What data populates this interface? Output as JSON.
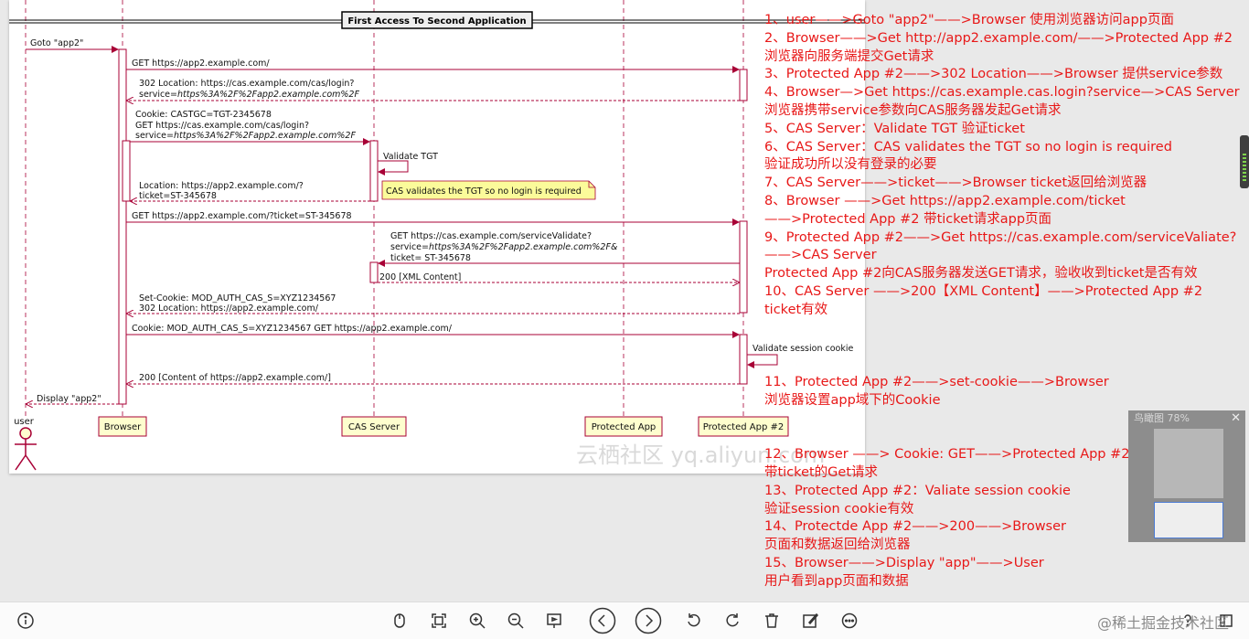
{
  "diagram": {
    "title": "First Access To Second Application",
    "participants": {
      "user": "user",
      "browser": "Browser",
      "cas": "CAS Server",
      "app1": "Protected App",
      "app2": "Protected App #2"
    },
    "messages": {
      "m1": "Goto \"app2\"",
      "m2": "GET https://app2.example.com/",
      "m3a": "302 Location: https://cas.example.com/cas/login?",
      "m3b_plain": "service=",
      "m3b_italic": "https%3A%2F%2Fapp2.example.com%2F",
      "m4a": "Cookie: CASTGC=TGT-2345678",
      "m4b": "GET https://cas.example.com/cas/login?",
      "m4c_plain": "service=",
      "m4c_italic": "https%3A%2F%2Fapp2.example.com%2F",
      "m5": "Validate TGT",
      "note": "CAS validates the TGT so no login is required",
      "m6a": "Location: https://app2.example.com/?",
      "m6b": "ticket=ST-345678",
      "m7": "GET https://app2.example.com/?ticket=ST-345678",
      "m8a": "GET https://cas.example.com/serviceValidate?",
      "m8b_plain": "service=",
      "m8b_italic": "https%3A%2F%2Fapp2.example.com%2F&",
      "m8c": "ticket= ST-345678",
      "m9": "200 [XML Content]",
      "m10a": "Set-Cookie: MOD_AUTH_CAS_S=XYZ1234567",
      "m10b": "302 Location: https://app2.example.com/",
      "m11": "Cookie: MOD_AUTH_CAS_S=XYZ1234567 GET https://app2.example.com/",
      "m12": "Validate session cookie",
      "m13": "200 [Content of https://app2.example.com/]",
      "m14": "Display \"app2\""
    }
  },
  "watermark_center": "云栖社区 yq.aliyun.com",
  "watermark_corner": "@稀土掘金技术社区",
  "notes": [
    "1、user——>Goto \"app2\"——>Browser 使用浏览器访问app页面",
    "2、Browser——>Get http://app2.example.com/——>Protected App #2",
    "浏览器向服务端提交Get请求",
    "3、Protected App #2——>302 Location——>Browser 提供service参数",
    "4、Browser—>Get https://cas.example.cas.login?service—>CAS Server",
    "浏览器携带service参数向CAS服务器发起Get请求",
    "5、CAS Server：Validate TGT 验证ticket",
    "6、CAS Server：CAS validates the TGT so no login is required",
    "验证成功所以没有登录的必要",
    "7、CAS Server——>ticket——>Browser ticket返回给浏览器",
    "8、Browser ——>Get https://app2.example.com/ticket",
    "——>Protected App #2 带ticket请求app页面",
    "9、Protected App #2——>Get https://cas.example.com/serviceValiate?",
    "——>CAS Server",
    "Protected App #2向CAS服务器发送GET请求，验收收到ticket是否有效",
    "10、CAS Server ——>200【XML Content】——>Protected App #2",
    "ticket有效",
    "",
    "",
    "",
    "11、Protected App #2——>set-cookie——>Browser",
    "浏览器设置app域下的Cookie",
    "",
    "",
    "12、Browser ——> Cookie: GET——>Protected App #2",
    "带ticket的Get请求",
    "13、Protected App #2：Valiate session cookie",
    "验证session cookie有效",
    "14、Protectde App #2——>200——>Browser",
    "页面和数据返回给浏览器",
    "15、Browser——>Display \"app\"——>User",
    "用户看到app页面和数据"
  ],
  "thumbnail": {
    "title": "鸟瞰图 78%",
    "close": "✕"
  },
  "toolbar": {
    "buttons": [
      "info",
      "hand",
      "fit",
      "zoom-in",
      "zoom-out",
      "present",
      "prev",
      "next",
      "rotate-left",
      "rotate-right",
      "delete",
      "edit",
      "more",
      "help",
      "share"
    ]
  }
}
